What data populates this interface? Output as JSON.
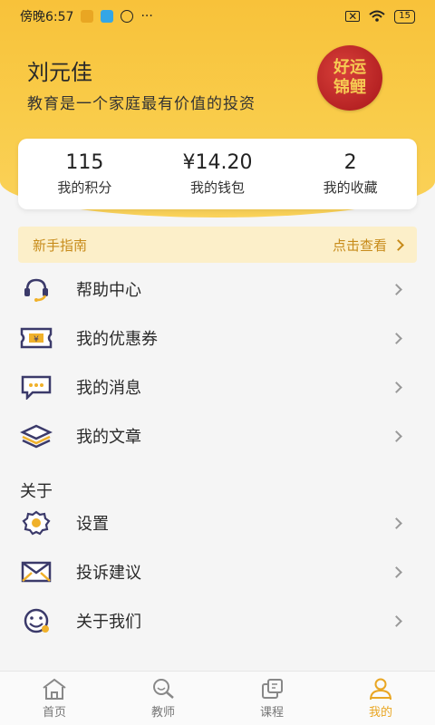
{
  "status_bar": {
    "time": "傍晚6:57",
    "battery": "15"
  },
  "profile": {
    "name": "刘元佳",
    "motto": "教育是一个家庭最有价值的投资",
    "avatar_text": [
      "好运",
      "锦鲤"
    ]
  },
  "stats": [
    {
      "value": "115",
      "label": "我的积分"
    },
    {
      "value": "¥14.20",
      "label": "我的钱包"
    },
    {
      "value": "2",
      "label": "我的收藏"
    }
  ],
  "guide": {
    "label": "新手指南",
    "link": "点击查看"
  },
  "menu": [
    {
      "icon": "headset-icon",
      "label": "帮助中心"
    },
    {
      "icon": "coupon-icon",
      "label": "我的优惠券"
    },
    {
      "icon": "message-icon",
      "label": "我的消息"
    },
    {
      "icon": "layers-icon",
      "label": "我的文章"
    }
  ],
  "about_section": {
    "title": "关于",
    "items": [
      {
        "icon": "settings-icon",
        "label": "设置"
      },
      {
        "icon": "mail-icon",
        "label": "投诉建议"
      },
      {
        "icon": "smiley-icon",
        "label": "关于我们"
      }
    ]
  },
  "tabs": [
    {
      "icon": "home-icon",
      "label": "首页"
    },
    {
      "icon": "teacher-icon",
      "label": "教师"
    },
    {
      "icon": "course-icon",
      "label": "课程"
    },
    {
      "icon": "profile-icon",
      "label": "我的",
      "active": true
    }
  ],
  "colors": {
    "accent": "#e9a623",
    "hero": "#f9c845",
    "icon_dark": "#3b3a6a"
  }
}
